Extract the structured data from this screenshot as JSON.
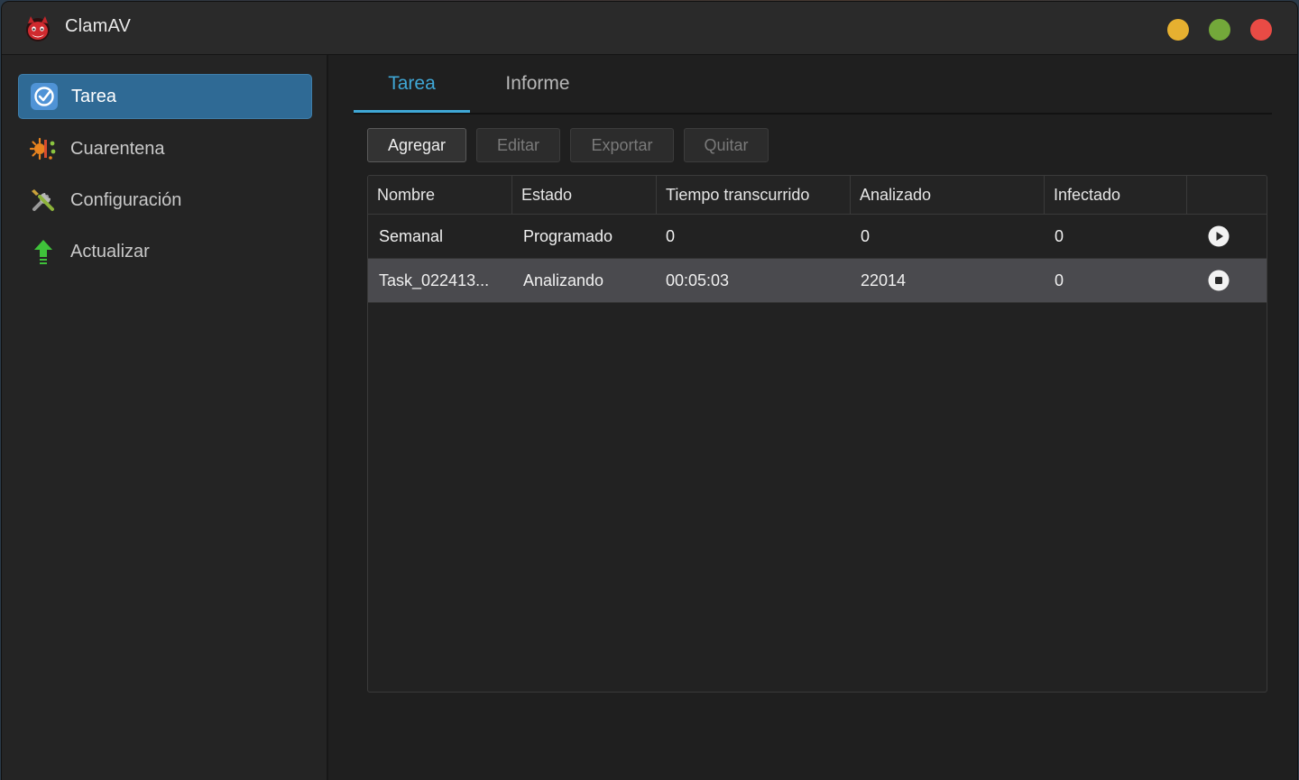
{
  "app": {
    "title": "ClamAV",
    "window_buttons": {
      "minimize_color": "#e6b030",
      "maximize_color": "#73a83a",
      "close_color": "#e94b45"
    }
  },
  "sidebar": {
    "items": [
      {
        "label": "Tarea",
        "icon": "task-check-icon",
        "active": true
      },
      {
        "label": "Cuarentena",
        "icon": "quarantine-virus-icon",
        "active": false
      },
      {
        "label": "Configuración",
        "icon": "wrench-screwdriver-icon",
        "active": false
      },
      {
        "label": "Actualizar",
        "icon": "update-arrow-up-icon",
        "active": false
      }
    ]
  },
  "main": {
    "tabs": [
      {
        "label": "Tarea",
        "active": true
      },
      {
        "label": "Informe",
        "active": false
      }
    ],
    "toolbar": {
      "add_label": "Agregar",
      "edit_label": "Editar",
      "export_label": "Exportar",
      "remove_label": "Quitar"
    },
    "table": {
      "columns": [
        "Nombre",
        "Estado",
        "Tiempo transcurrido",
        "Analizado",
        "Infectado",
        ""
      ],
      "rows": [
        {
          "name": "Semanal",
          "status": "Programado",
          "elapsed": "0",
          "scanned": "0",
          "infected": "0",
          "action_icon": "play-icon",
          "selected": false
        },
        {
          "name": "Task_022413...",
          "status": "Analizando",
          "elapsed": "00:05:03",
          "scanned": "22014",
          "infected": "0",
          "action_icon": "stop-icon",
          "selected": true
        }
      ]
    }
  },
  "colors": {
    "accent": "#3fa7d6",
    "sidebar_active": "#2f6a95"
  }
}
